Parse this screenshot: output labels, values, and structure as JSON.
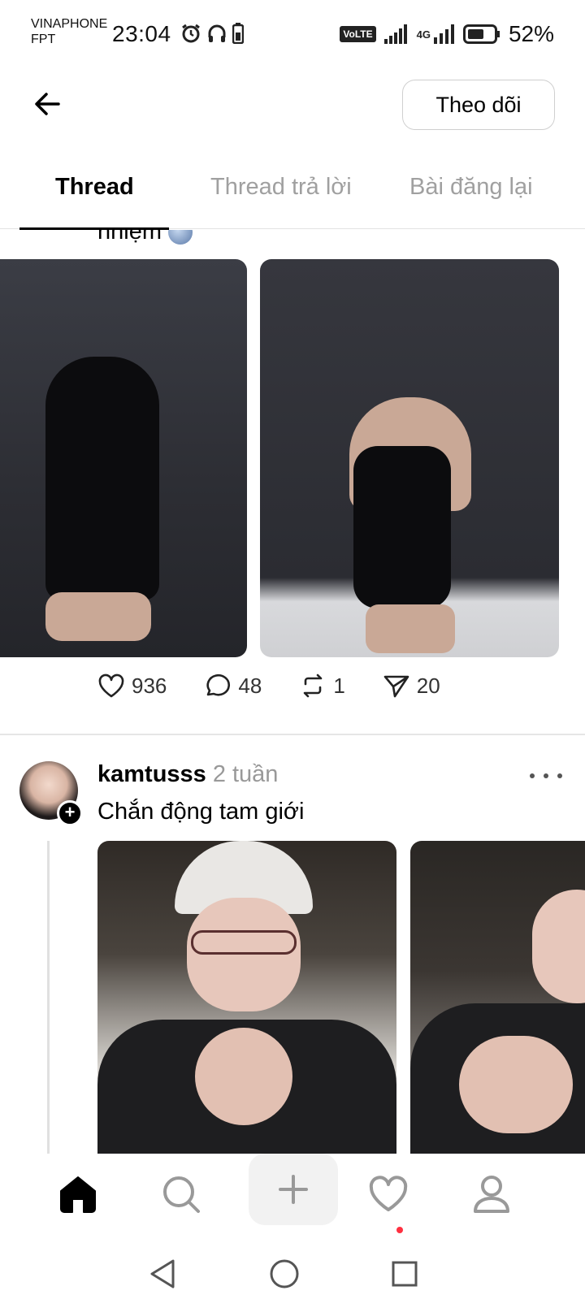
{
  "status_bar": {
    "carrier_line1": "VINAPHONE",
    "carrier_line2": "FPT",
    "time": "23:04",
    "volte_label": "VoLTE",
    "network_label": "4G",
    "battery_percent": "52%"
  },
  "header": {
    "back_icon": "arrow-left-icon",
    "follow_label": "Theo dõi"
  },
  "tabs": [
    {
      "label": "Thread",
      "active": true
    },
    {
      "label": "Thread trả lời",
      "active": false
    },
    {
      "label": "Bài đăng lại",
      "active": false
    }
  ],
  "post1": {
    "truncated_text": "nhiệm",
    "likes": "936",
    "comments": "48",
    "reposts": "1",
    "shares": "20"
  },
  "post2": {
    "username": "kamtusss",
    "time": "2 tuần",
    "text": "Chắn động tam giới"
  },
  "bottom_nav": {
    "items": [
      "home-icon",
      "search-icon",
      "plus-icon",
      "heart-icon",
      "profile-icon"
    ]
  },
  "system_nav": {
    "items": [
      "back-triangle-icon",
      "home-circle-icon",
      "recents-square-icon"
    ]
  }
}
